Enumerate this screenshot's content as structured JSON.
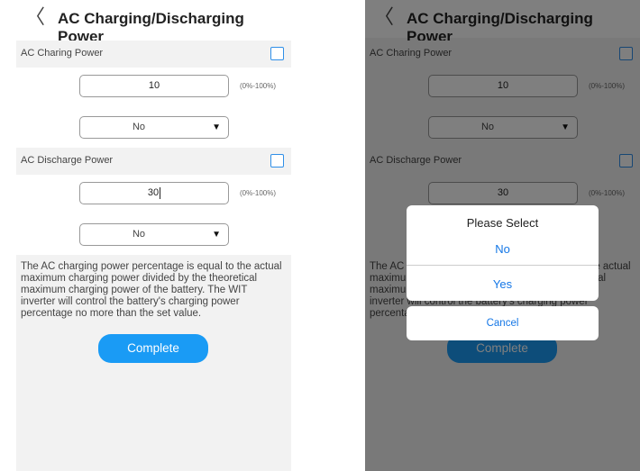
{
  "header": {
    "back_glyph": "〈",
    "title": "AC Charging/Discharging Power"
  },
  "charge": {
    "label": "AC Charing Power",
    "value": "10",
    "range": "(0%-100%)",
    "select_value": "No"
  },
  "discharge": {
    "label": "AC Discharge Power",
    "value": "30",
    "range": "(0%-100%)",
    "select_value": "No"
  },
  "info_text": "The AC charging power percentage is equal to the actual maximum charging power divided by the theoretical maximum charging power of the battery. The WIT inverter will control the battery's charging power percentage no more than the set value.",
  "complete_label": "Complete",
  "dialog": {
    "title": "Please Select",
    "options": [
      "No",
      "Yes"
    ],
    "cancel": "Cancel"
  },
  "icons": {
    "back": "back-chevron-icon",
    "dropdown": "dropdown-arrow-icon",
    "checkbox": "checkbox-icon"
  },
  "colors": {
    "accent": "#1a9bf5",
    "link": "#1577e6",
    "checkbox_border": "#2f8fe8",
    "section_bg": "#f2f2f2"
  },
  "arrow_glyph": "▼"
}
